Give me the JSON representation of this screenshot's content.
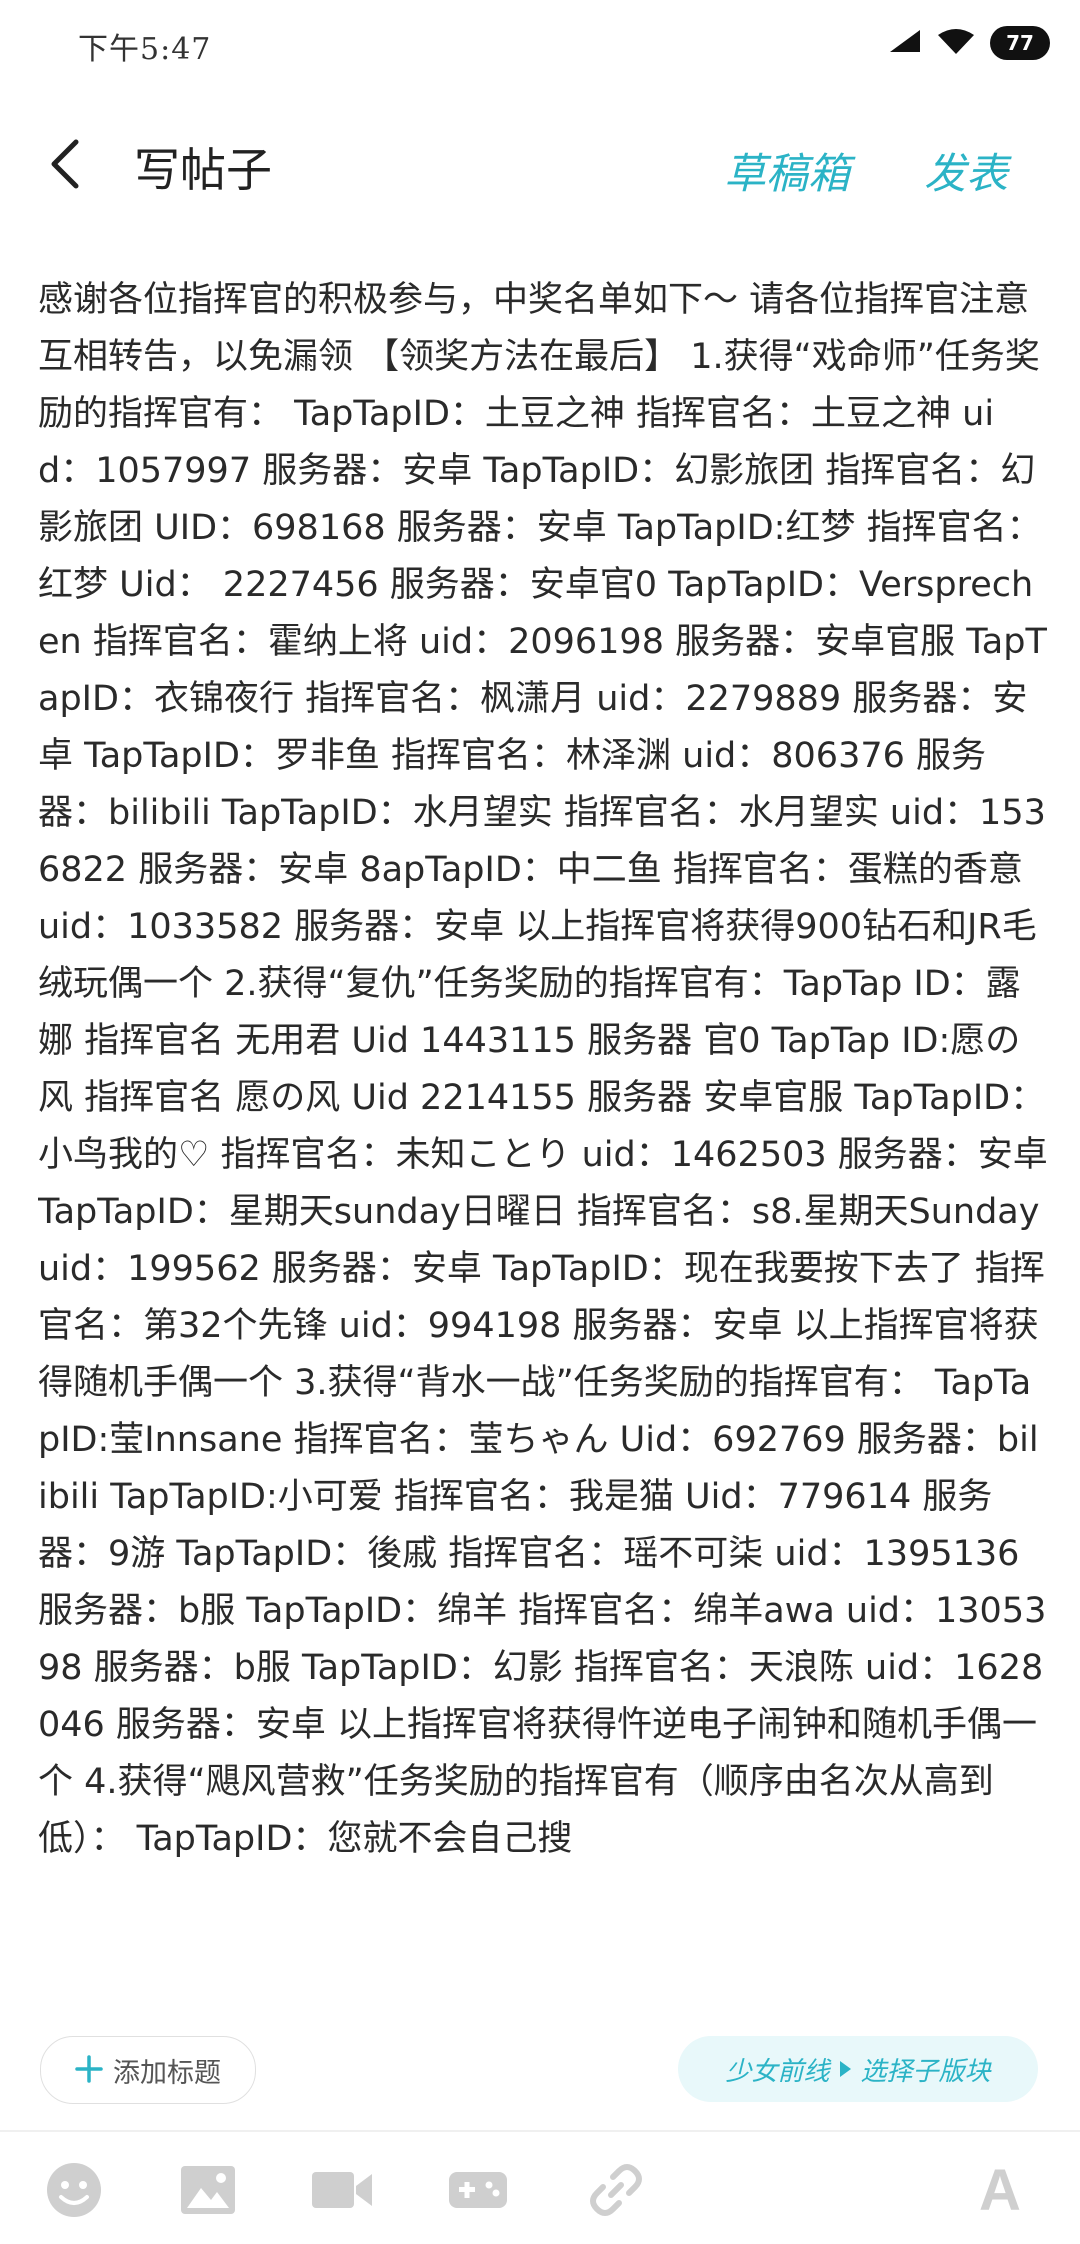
{
  "status_bar": {
    "time": "下午5:47",
    "battery": "77"
  },
  "header": {
    "title": "写帖子",
    "drafts_label": "草稿箱",
    "publish_label": "发表"
  },
  "post": {
    "body": "感谢各位指挥官的积极参与，中奖名单如下～ 请各位指挥官注意互相转告，以免漏领 【领奖方法在最后】 1.获得“戏命师”任务奖励的指挥官有： TapTapID：土豆之神 指挥官名：土豆之神 uid：1057997 服务器：安卓 TapTapID：幻影旅团 指挥官名：幻影旅团 UID：698168 服务器：安卓 TapTapID:红梦 指挥官名： 红梦 Uid： 2227456 服务器：安卓官0 TapTapID：Versprechen 指挥官名：霍纳上将 uid：2096198 服务器：安卓官服 TapTapID：衣锦夜行 指挥官名：枫潇月 uid：2279889 服务器：安卓 TapTapID：罗非鱼 指挥官名：林泽渊 uid：806376 服务器：bilibili TapTapID：水月望实 指挥官名：水月望实 uid：1536822 服务器：安卓 8apTapID：中二鱼 指挥官名：蛋糕的香意 uid：1033582 服务器：安卓 以上指挥官将获得900钻石和JR毛绒玩偶一个 2.获得“复仇”任务奖励的指挥官有：TapTap ID：露娜 指挥官名 无用君 Uid 1443115 服务器 官0 TapTap ID:愿の风 指挥官名 愿の风 Uid 2214155 服务器 安卓官服 TapTapID：小鸟我的♡ 指挥官名：未知ことり uid：1462503 服务器：安卓 TapTapID：星期天sunday日曜日 指挥官名：s8.星期天Sunday uid：199562 服务器：安卓 TapTapID：现在我要按下去了 指挥官名：第32个先锋 uid：994198 服务器：安卓 以上指挥官将获得随机手偶一个 3.获得“背水一战”任务奖励的指挥官有： TapTapID:莹Innsane 指挥官名：莹ちゃん Uid：692769 服务器：bilibili TapTapID:小可爱 指挥官名：我是猫 Uid：779614 服务器：9游 TapTapID：後戚 指挥官名：瑶不可柒 uid：1395136 服务器：b服 TapTapID：绵羊 指挥官名：绵羊awa uid：1305398 服务器：b服 TapTapID：幻影 指挥官名：天浪陈 uid：1628046 服务器：安卓 以上指挥官将获得忤逆电子闹钟和随机手偶一个 4.获得“飓风营救”任务奖励的指挥官有（顺序由名次从高到低）： TapTapID：您就不会自己搜"
  },
  "actions": {
    "add_title_label": "添加标题",
    "board_name": "少女前线",
    "board_select": "选择子版块"
  },
  "toolbar": {
    "font_label": "A"
  },
  "colors": {
    "accent": "#2bb3c6",
    "icon_gray": "#cfcfcf"
  }
}
